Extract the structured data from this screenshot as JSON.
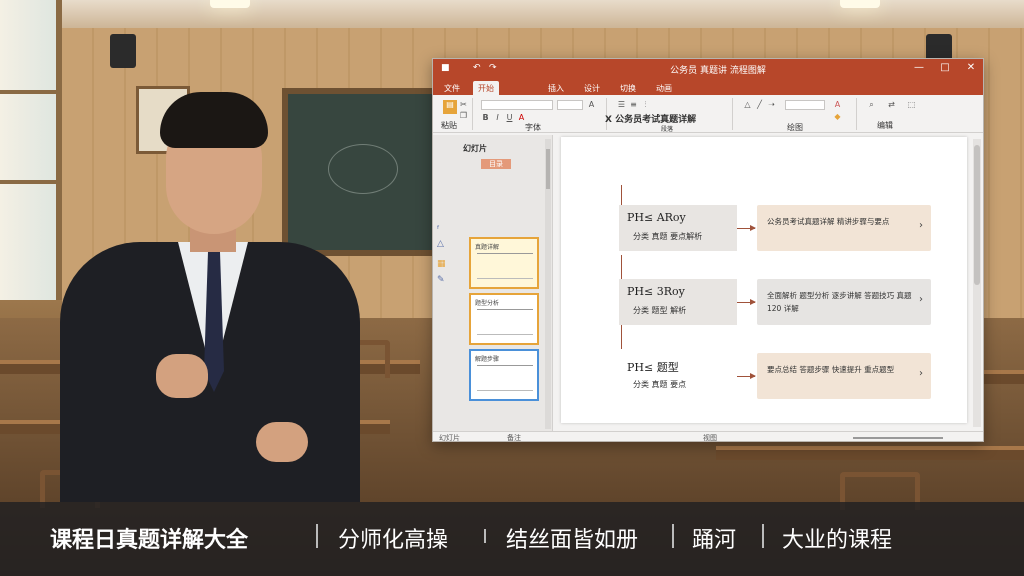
{
  "window": {
    "title": "公务员 真题讲 流程图解",
    "quick_access": [
      "↶",
      "↷"
    ],
    "controls": [
      "—",
      "□",
      "✕"
    ]
  },
  "ribbon": {
    "tabs": [
      {
        "label": "文件",
        "active": false
      },
      {
        "label": "开始",
        "active": true
      },
      {
        "label": "插入",
        "active": false
      },
      {
        "label": "设计",
        "active": false
      },
      {
        "label": "切换",
        "active": false
      },
      {
        "label": "动画",
        "active": false
      }
    ],
    "heading": "X 公务员考试真题详解",
    "group_labels": [
      "粘贴",
      "字体",
      "段落",
      "绘图",
      "编辑"
    ]
  },
  "thumbnails": {
    "pane_title": "幻灯片",
    "section_label": "目录",
    "items": [
      {
        "label": "真题详解"
      },
      {
        "label": "题型分析"
      },
      {
        "label": "解题步骤"
      }
    ]
  },
  "slide": {
    "steps": [
      {
        "code": "PH≤ ARoy",
        "sub": "分类 真题 要点解析",
        "detail": "公务员考试真题详解 精讲步骤与要点",
        "tone": "warm"
      },
      {
        "code": "PH≤ 3Roy",
        "sub": "分类 题型 解析",
        "detail": "全面解析 题型分析 逐步讲解 答题技巧 真题 120 详解",
        "tone": "gray"
      },
      {
        "code": "PH≤ 题型",
        "sub": "分类 真题 要点",
        "detail": "要点总结 答题步骤 快速提升 重点题型",
        "tone": "warm"
      }
    ]
  },
  "status": {
    "left": [
      "幻灯片",
      "备注"
    ],
    "right": "视图"
  },
  "caption": {
    "segments": [
      "课程日真题详解大全",
      "分师化高操",
      "结丝面皆如册",
      "踊河",
      "大业的课程"
    ]
  },
  "colors": {
    "accent": "#b7472a",
    "step_warm": "#f2e4d6",
    "step_gray": "#e6e4e2"
  }
}
